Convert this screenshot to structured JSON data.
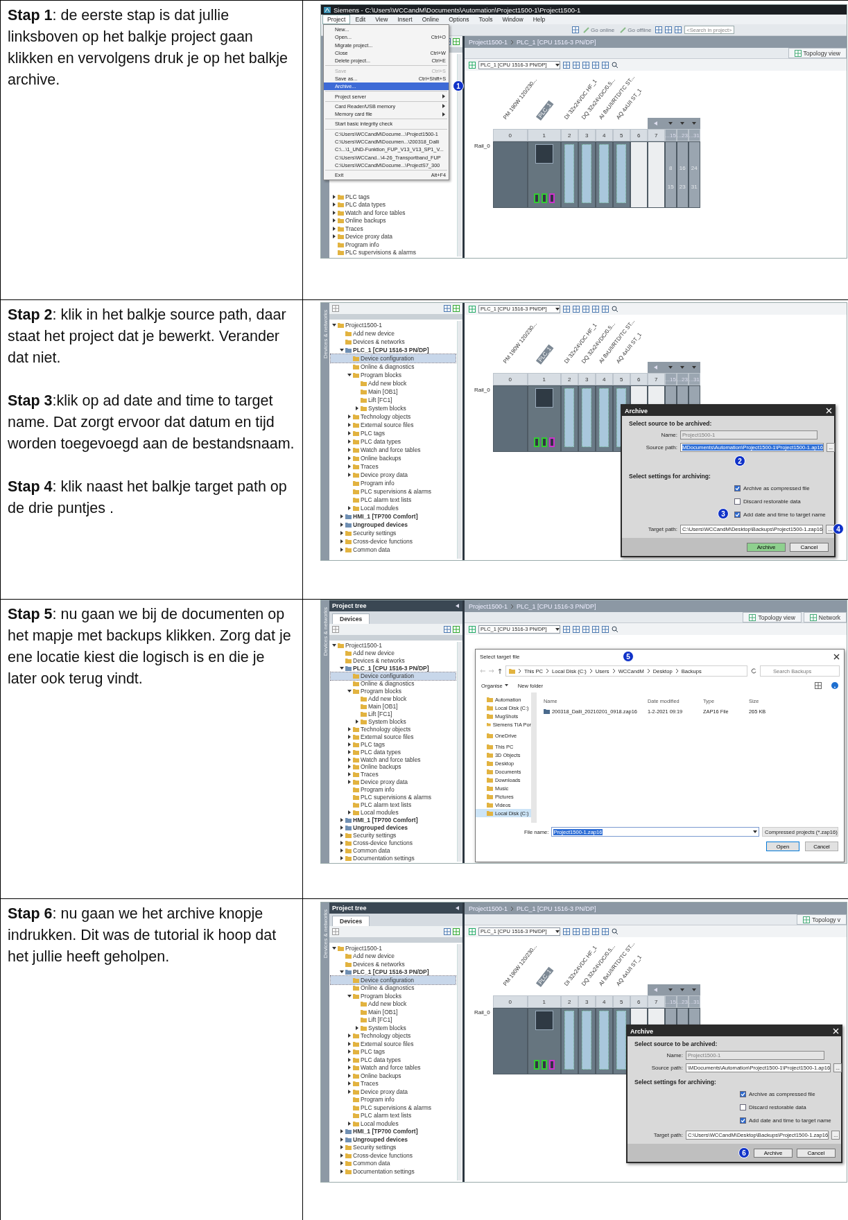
{
  "steps": [
    {
      "text": [
        "**Stap 1**: de eerste stap is dat jullie linksboven op het balkje project gaan klikken en vervolgens druk je op het balkje archive."
      ],
      "screenshot": {
        "title_bar": "Siemens  -  C:\\Users\\WCCandM\\Documents\\Automation\\Project1500-1\\Project1500-1",
        "menu_bar": [
          {
            "label": "Project",
            "selected": true
          },
          {
            "label": "Edit",
            "selected": false
          },
          {
            "label": "View",
            "selected": false
          },
          {
            "label": "Insert",
            "selected": false
          },
          {
            "label": "Online",
            "selected": false
          },
          {
            "label": "Options",
            "selected": false
          },
          {
            "label": "Tools",
            "selected": false
          },
          {
            "label": "Window",
            "selected": false
          },
          {
            "label": "Help",
            "selected": false
          }
        ],
        "toolbar": {
          "buttons": [
            "Go online",
            "Go offline"
          ],
          "search": {
            "placeholder": "<Search in project>"
          }
        },
        "project_tree": {
          "items": [
            {
              "label": "PLC tags",
              "selected": false,
              "expanded": false
            },
            {
              "label": "PLC data types",
              "selected": false,
              "expanded": false
            },
            {
              "label": "Watch and force tables",
              "selected": false,
              "expanded": false
            },
            {
              "label": "Online backups",
              "selected": false,
              "expanded": false
            },
            {
              "label": "Traces",
              "selected": false,
              "expanded": false
            },
            {
              "label": "Device proxy data",
              "selected": false,
              "expanded": false
            },
            {
              "label": "Program info",
              "selected": false
            },
            {
              "label": "PLC supervisions & alarms",
              "selected": false
            }
          ]
        },
        "editor": {
          "breadcrumb": [
            "Project1500-1",
            "PLC_1 [CPU 1516-3 PN/DP]"
          ],
          "view_tabs": [
            "Topology view"
          ],
          "device_select": "PLC_1 [CPU 1516-3 PN/DP]",
          "rack": {
            "rail": "Rail_0",
            "modules": [
              {
                "kind": "power",
                "slot": "0",
                "label": "PM 190W 120/230..."
              },
              {
                "kind": "cpu",
                "slot": "1",
                "label": "PLC_1"
              },
              {
                "kind": "io",
                "slot": "2",
                "label": "DI 32x24VDC HF_1"
              },
              {
                "kind": "io",
                "slot": "3",
                "label": "DQ 32x24VDC/0.5..."
              },
              {
                "kind": "io",
                "slot": "4",
                "label": "AI 8xU/I/RTD/TC ST..."
              },
              {
                "kind": "io",
                "slot": "5",
                "label": "AQ 4xU/I ST_1"
              },
              {
                "kind": "empty",
                "slot": "6"
              },
              {
                "kind": "empty",
                "slot": "7"
              },
              {
                "kind": "ext",
                "slot": "...15",
                "range": [
                  "8",
                  "15"
                ]
              },
              {
                "kind": "ext",
                "slot": "...23",
                "range": [
                  "16",
                  "23"
                ]
              },
              {
                "kind": "ext",
                "slot": "...31",
                "range": [
                  "24",
                  "31"
                ]
              }
            ]
          }
        },
        "menu": {
          "items": [
            {
              "kind": "item",
              "label": "New...",
              "selected": false,
              "disabled": false
            },
            {
              "kind": "item",
              "label": "Open...",
              "shortcut": "Ctrl+O",
              "selected": false,
              "disabled": false
            },
            {
              "kind": "item",
              "label": "Migrate project...",
              "selected": false,
              "disabled": false
            },
            {
              "kind": "item",
              "label": "Close",
              "shortcut": "Ctrl+W",
              "selected": false,
              "disabled": false
            },
            {
              "kind": "item",
              "label": "Delete project...",
              "shortcut": "Ctrl+E",
              "selected": false,
              "disabled": false
            },
            {
              "kind": "separator"
            },
            {
              "kind": "item",
              "label": "Save",
              "shortcut": "Ctrl+S",
              "selected": false,
              "disabled": true
            },
            {
              "kind": "item",
              "label": "Save as...",
              "shortcut": "Ctrl+Shift+S",
              "selected": false,
              "disabled": false
            },
            {
              "kind": "item",
              "label": "Archive...",
              "selected": true,
              "disabled": false,
              "marker": "1"
            },
            {
              "kind": "separator"
            },
            {
              "kind": "item",
              "label": "Project server",
              "selected": false,
              "disabled": false,
              "submenu": true
            },
            {
              "kind": "separator"
            },
            {
              "kind": "item",
              "label": "Card Reader/USB memory",
              "selected": false,
              "disabled": false,
              "submenu": true
            },
            {
              "kind": "item",
              "label": "Memory card file",
              "selected": false,
              "disabled": false,
              "submenu": true
            },
            {
              "kind": "separator"
            },
            {
              "kind": "item",
              "label": "Start basic integrity check",
              "selected": false,
              "disabled": false
            },
            {
              "kind": "separator"
            },
            {
              "kind": "item",
              "label": "C:\\Users\\WCCandM\\Docume...\\Project1500-1",
              "selected": false,
              "disabled": false
            },
            {
              "kind": "item",
              "label": "C:\\Users\\WCCandM\\Documen...\\200318_Dalli",
              "selected": false,
              "disabled": false
            },
            {
              "kind": "item",
              "label": "C:\\...\\1_UND-Funktion_FUP_V13_V13_SP1_V...",
              "selected": false,
              "disabled": false
            },
            {
              "kind": "item",
              "label": "C:\\Users\\WCCand...\\4-26_Transportband_FUP",
              "selected": false,
              "disabled": false
            },
            {
              "kind": "item",
              "label": "C:\\Users\\WCCandM\\Docume...\\ProjectS7_300",
              "selected": false,
              "disabled": false
            },
            {
              "kind": "separator"
            },
            {
              "kind": "item",
              "label": "Exit",
              "shortcut": "Alt+F4",
              "selected": false,
              "disabled": false
            }
          ]
        }
      }
    },
    {
      "text": [
        "**Stap 2**: klik in het balkje source path, daar staat het project dat je bewerkt. Verander dat niet.",
        "**Stap 3**:klik op ad date and time to target name. Dat zorgt ervoor dat datum en tijd worden toegevoegd aan de bestandsnaam.",
        "**Stap 4**: klik naast het balkje target path op de drie puntjes ."
      ],
      "screenshot": {
        "project_tree": {
          "side_label": "Devices & networks",
          "items": [
            {
              "label": "Project1500-1",
              "selected": false,
              "expanded": true,
              "children": [
                {
                  "label": "Add new device",
                  "selected": false
                },
                {
                  "label": "Devices & networks",
                  "selected": false
                },
                {
                  "label": "PLC_1 [CPU 1516-3 PN/DP]",
                  "selected": false,
                  "expanded": true,
                  "bold": true,
                  "children": [
                    {
                      "label": "Device configuration",
                      "selected": true
                    },
                    {
                      "label": "Online & diagnostics",
                      "selected": false
                    },
                    {
                      "label": "Program blocks",
                      "selected": false,
                      "expanded": true,
                      "children": [
                        {
                          "label": "Add new block",
                          "selected": false
                        },
                        {
                          "label": "Main [OB1]",
                          "selected": false
                        },
                        {
                          "label": "Lift [FC1]",
                          "selected": false
                        },
                        {
                          "label": "System blocks",
                          "selected": false,
                          "expanded": false
                        }
                      ]
                    },
                    {
                      "label": "Technology objects",
                      "selected": false,
                      "expanded": false
                    },
                    {
                      "label": "External source files",
                      "selected": false,
                      "expanded": false
                    },
                    {
                      "label": "PLC tags",
                      "selected": false,
                      "expanded": false
                    },
                    {
                      "label": "PLC data types",
                      "selected": false,
                      "expanded": false
                    },
                    {
                      "label": "Watch and force tables",
                      "selected": false,
                      "expanded": false
                    },
                    {
                      "label": "Online backups",
                      "selected": false,
                      "expanded": false
                    },
                    {
                      "label": "Traces",
                      "selected": false,
                      "expanded": false
                    },
                    {
                      "label": "Device proxy data",
                      "selected": false,
                      "expanded": false
                    },
                    {
                      "label": "Program info",
                      "selected": false
                    },
                    {
                      "label": "PLC supervisions & alarms",
                      "selected": false
                    },
                    {
                      "label": "PLC alarm text lists",
                      "selected": false
                    },
                    {
                      "label": "Local modules",
                      "selected": false,
                      "expanded": false
                    }
                  ]
                },
                {
                  "label": "HMI_1 [TP700 Comfort]",
                  "selected": false,
                  "expanded": false,
                  "bold": true
                },
                {
                  "label": "Ungrouped devices",
                  "selected": false,
                  "expanded": false,
                  "bold": true
                },
                {
                  "label": "Security settings",
                  "selected": false,
                  "expanded": false
                },
                {
                  "label": "Cross-device functions",
                  "selected": false,
                  "expanded": false
                },
                {
                  "label": "Common data",
                  "selected": false,
                  "expanded": false
                }
              ]
            }
          ]
        },
        "editor": {
          "device_select": "PLC_1 [CPU 1516-3 PN/DP]",
          "rack": {
            "rail": "Rail_0",
            "modules": [
              {
                "kind": "power",
                "slot": "0",
                "label": "PM 190W 120/230..."
              },
              {
                "kind": "cpu",
                "slot": "1",
                "label": "PLC_1"
              },
              {
                "kind": "io",
                "slot": "2",
                "label": "DI 32x24VDC HF_1"
              },
              {
                "kind": "io",
                "slot": "3",
                "label": "DQ 32x24VDC/0.5..."
              },
              {
                "kind": "io",
                "slot": "4",
                "label": "AI 8xU/I/RTD/TC ST..."
              },
              {
                "kind": "io",
                "slot": "5",
                "label": "AQ 4xU/I ST_1"
              },
              {
                "kind": "empty",
                "slot": "6"
              },
              {
                "kind": "empty",
                "slot": "7"
              },
              {
                "kind": "ext",
                "slot": "...15"
              },
              {
                "kind": "ext",
                "slot": "...23"
              },
              {
                "kind": "ext",
                "slot": "...31"
              }
            ]
          }
        },
        "archive_dialog": {
          "title": "Archive",
          "source_heading": "Select source to be archived:",
          "fields": [
            {
              "label": "Name:",
              "value": "Project1500-1",
              "disabled": true,
              "highlighted": false
            },
            {
              "label": "Source path:",
              "value": "MDocuments\\Automation\\Project1500-1\\Project1500-1.ap16",
              "disabled": false,
              "highlighted": true,
              "browse": "...",
              "marker": "2"
            }
          ],
          "settings_heading": "Select settings for archiving:",
          "options": [
            {
              "label": "Archive as compressed file",
              "checked": true
            },
            {
              "label": "Discard restorable data",
              "checked": false
            },
            {
              "label": "Add date and time to target name",
              "checked": true,
              "marker": "3"
            }
          ],
          "target": {
            "label": "Target path:",
            "value": "C:\\Users\\WCCandM\\Desktop\\Backups\\Project1500-1.zap16",
            "browse": "...",
            "marker": "4"
          },
          "buttons": [
            {
              "label": "Archive",
              "focused": true
            },
            {
              "label": "Cancel",
              "focused": false
            }
          ]
        }
      }
    },
    {
      "text": [
        "**Stap 5**: nu gaan we bij de documenten op het mapje met backups klikken. Zorg dat je ene locatie kiest die logisch is en die je later ook terug vindt."
      ],
      "screenshot": {
        "project_tree": {
          "header": "Project tree",
          "tab": "Devices",
          "side_label": "Devices & networks",
          "items": [
            {
              "label": "Project1500-1",
              "selected": false,
              "expanded": true,
              "children": [
                {
                  "label": "Add new device",
                  "selected": false
                },
                {
                  "label": "Devices & networks",
                  "selected": false
                },
                {
                  "label": "PLC_1 [CPU 1516-3 PN/DP]",
                  "selected": false,
                  "expanded": true,
                  "bold": true,
                  "children": [
                    {
                      "label": "Device configuration",
                      "selected": true
                    },
                    {
                      "label": "Online & diagnostics",
                      "selected": false
                    },
                    {
                      "label": "Program blocks",
                      "selected": false,
                      "expanded": true,
                      "children": [
                        {
                          "label": "Add new block",
                          "selected": false
                        },
                        {
                          "label": "Main [OB1]",
                          "selected": false
                        },
                        {
                          "label": "Lift [FC1]",
                          "selected": false
                        },
                        {
                          "label": "System blocks",
                          "selected": false,
                          "expanded": false
                        }
                      ]
                    },
                    {
                      "label": "Technology objects",
                      "selected": false,
                      "expanded": false
                    },
                    {
                      "label": "External source files",
                      "selected": false,
                      "expanded": false
                    },
                    {
                      "label": "PLC tags",
                      "selected": false,
                      "expanded": false
                    },
                    {
                      "label": "PLC data types",
                      "selected": false,
                      "expanded": false
                    },
                    {
                      "label": "Watch and force tables",
                      "selected": false,
                      "expanded": false
                    },
                    {
                      "label": "Online backups",
                      "selected": false,
                      "expanded": false
                    },
                    {
                      "label": "Traces",
                      "selected": false,
                      "expanded": false
                    },
                    {
                      "label": "Device proxy data",
                      "selected": false,
                      "expanded": false
                    },
                    {
                      "label": "Program info",
                      "selected": false
                    },
                    {
                      "label": "PLC supervisions & alarms",
                      "selected": false
                    },
                    {
                      "label": "PLC alarm text lists",
                      "selected": false
                    },
                    {
                      "label": "Local modules",
                      "selected": false,
                      "expanded": false
                    }
                  ]
                },
                {
                  "label": "HMI_1 [TP700 Comfort]",
                  "selected": false,
                  "expanded": false,
                  "bold": true
                },
                {
                  "label": "Ungrouped devices",
                  "selected": false,
                  "expanded": false,
                  "bold": true
                },
                {
                  "label": "Security settings",
                  "selected": false,
                  "expanded": false
                },
                {
                  "label": "Cross-device functions",
                  "selected": false,
                  "expanded": false
                },
                {
                  "label": "Common data",
                  "selected": false,
                  "expanded": false
                },
                {
                  "label": "Documentation settings",
                  "selected": false,
                  "expanded": false
                }
              ]
            }
          ]
        },
        "editor": {
          "breadcrumb": [
            "Project1500-1",
            "PLC_1 [CPU 1516-3 PN/DP]"
          ],
          "view_tabs": [
            "Topology view",
            "Network"
          ],
          "device_select": "PLC_1 [CPU 1516-3 PN/DP]"
        },
        "file_dialog": {
          "title": "Select target file",
          "marker": "5",
          "address": [
            "This PC",
            "Local Disk (C:)",
            "Users",
            "WCCandM",
            "Desktop",
            "Backups"
          ],
          "search": {
            "placeholder": "Search Backups"
          },
          "commands": [
            "Organise",
            "New folder"
          ],
          "nav_groups": [
            [
              {
                "label": "Automation",
                "selected": false
              },
              {
                "label": "Local Disk (C:)",
                "selected": false
              },
              {
                "label": "MugShots",
                "selected": false
              },
              {
                "label": "Siemens TIA Por",
                "selected": false
              }
            ],
            [
              {
                "label": "OneDrive",
                "selected": false
              }
            ],
            [
              {
                "label": "This PC",
                "selected": false
              },
              {
                "label": "3D Objects",
                "selected": false
              },
              {
                "label": "Desktop",
                "selected": false
              },
              {
                "label": "Documents",
                "selected": false
              },
              {
                "label": "Downloads",
                "selected": false
              },
              {
                "label": "Music",
                "selected": false
              },
              {
                "label": "Pictures",
                "selected": false
              },
              {
                "label": "Videos",
                "selected": false
              },
              {
                "label": "Local Disk (C:)",
                "selected": true
              }
            ]
          ],
          "columns": [
            "Name",
            "Date modified",
            "Type",
            "Size"
          ],
          "files": [
            {
              "name": "200318_Dalli_20210201_0918.zap16",
              "date": "1-2-2021 09:19",
              "type": "ZAP16 File",
              "size": "265 KB"
            }
          ],
          "file_name": {
            "label": "File name:",
            "value": "Project1500-1.zap16",
            "highlighted": true
          },
          "filter": "Compressed projects (*.zap16)",
          "buttons": [
            {
              "label": "Open",
              "focused": true
            },
            {
              "label": "Cancel",
              "focused": false
            }
          ]
        }
      }
    },
    {
      "text": [
        "**Stap 6**: nu gaan we het archive knopje indrukken. Dit was de tutorial ik hoop dat het jullie heeft geholpen."
      ],
      "screenshot": {
        "project_tree": {
          "header": "Project tree",
          "tab": "Devices",
          "side_label": "Devices & networks",
          "items": [
            {
              "label": "Project1500-1",
              "selected": false,
              "expanded": true,
              "children": [
                {
                  "label": "Add new device",
                  "selected": false
                },
                {
                  "label": "Devices & networks",
                  "selected": false
                },
                {
                  "label": "PLC_1 [CPU 1516-3 PN/DP]",
                  "selected": false,
                  "expanded": true,
                  "bold": true,
                  "children": [
                    {
                      "label": "Device configuration",
                      "selected": true
                    },
                    {
                      "label": "Online & diagnostics",
                      "selected": false
                    },
                    {
                      "label": "Program blocks",
                      "selected": false,
                      "expanded": true,
                      "children": [
                        {
                          "label": "Add new block",
                          "selected": false
                        },
                        {
                          "label": "Main [OB1]",
                          "selected": false
                        },
                        {
                          "label": "Lift [FC1]",
                          "selected": false
                        },
                        {
                          "label": "System blocks",
                          "selected": false,
                          "expanded": false
                        }
                      ]
                    },
                    {
                      "label": "Technology objects",
                      "selected": false,
                      "expanded": false
                    },
                    {
                      "label": "External source files",
                      "selected": false,
                      "expanded": false
                    },
                    {
                      "label": "PLC tags",
                      "selected": false,
                      "expanded": false
                    },
                    {
                      "label": "PLC data types",
                      "selected": false,
                      "expanded": false
                    },
                    {
                      "label": "Watch and force tables",
                      "selected": false,
                      "expanded": false
                    },
                    {
                      "label": "Online backups",
                      "selected": false,
                      "expanded": false
                    },
                    {
                      "label": "Traces",
                      "selected": false,
                      "expanded": false
                    },
                    {
                      "label": "Device proxy data",
                      "selected": false,
                      "expanded": false
                    },
                    {
                      "label": "Program info",
                      "selected": false
                    },
                    {
                      "label": "PLC supervisions & alarms",
                      "selected": false
                    },
                    {
                      "label": "PLC alarm text lists",
                      "selected": false
                    },
                    {
                      "label": "Local modules",
                      "selected": false,
                      "expanded": false
                    }
                  ]
                },
                {
                  "label": "HMI_1 [TP700 Comfort]",
                  "selected": false,
                  "expanded": false,
                  "bold": true
                },
                {
                  "label": "Ungrouped devices",
                  "selected": false,
                  "expanded": false,
                  "bold": true
                },
                {
                  "label": "Security settings",
                  "selected": false,
                  "expanded": false
                },
                {
                  "label": "Cross-device functions",
                  "selected": false,
                  "expanded": false
                },
                {
                  "label": "Common data",
                  "selected": false,
                  "expanded": false
                },
                {
                  "label": "Documentation settings",
                  "selected": false,
                  "expanded": false
                }
              ]
            }
          ]
        },
        "editor": {
          "breadcrumb": [
            "Project1500-1",
            "PLC_1 [CPU 1516-3 PN/DP]"
          ],
          "view_tabs": [
            "Topology v"
          ],
          "device_select": "PLC_1 [CPU 1516-3 PN/DP]",
          "rack": {
            "rail": "Rail_0",
            "modules": [
              {
                "kind": "power",
                "slot": "0",
                "label": "PM 190W 120/230..."
              },
              {
                "kind": "cpu",
                "slot": "1",
                "label": "PLC_1"
              },
              {
                "kind": "io",
                "slot": "2",
                "label": "DI 32x24VDC HF_1"
              },
              {
                "kind": "io",
                "slot": "3",
                "label": "DQ 32x24VDC/0.5..."
              },
              {
                "kind": "io",
                "slot": "4",
                "label": "AI 8xU/I/RTD/TC ST..."
              },
              {
                "kind": "io",
                "slot": "5",
                "label": "AQ 4xU/I ST_1"
              },
              {
                "kind": "empty",
                "slot": "6"
              },
              {
                "kind": "empty",
                "slot": "7"
              },
              {
                "kind": "ext",
                "slot": "...15"
              },
              {
                "kind": "ext",
                "slot": "...23"
              },
              {
                "kind": "ext",
                "slot": "...31"
              }
            ]
          }
        },
        "archive_dialog": {
          "title": "Archive",
          "source_heading": "Select source to be archived:",
          "fields": [
            {
              "label": "Name:",
              "value": "Project1500-1",
              "disabled": true,
              "highlighted": false
            },
            {
              "label": "Source path:",
              "value": "\\MDocuments\\Automation\\Project1500-1\\Project1500-1.ap16",
              "disabled": false,
              "highlighted": false,
              "browse": "..."
            }
          ],
          "settings_heading": "Select settings for archiving:",
          "options": [
            {
              "label": "Archive as compressed file",
              "checked": true
            },
            {
              "label": "Discard restorable data",
              "checked": false
            },
            {
              "label": "Add date and time to target name",
              "checked": true
            }
          ],
          "target": {
            "label": "Target path:",
            "value": "C:\\Users\\WCCandM\\Desktop\\Backups\\Project1500-1.zap16",
            "browse": "..."
          },
          "buttons": [
            {
              "label": "Archive",
              "focused": false,
              "marker": "6"
            },
            {
              "label": "Cancel",
              "focused": false
            }
          ]
        }
      }
    }
  ]
}
